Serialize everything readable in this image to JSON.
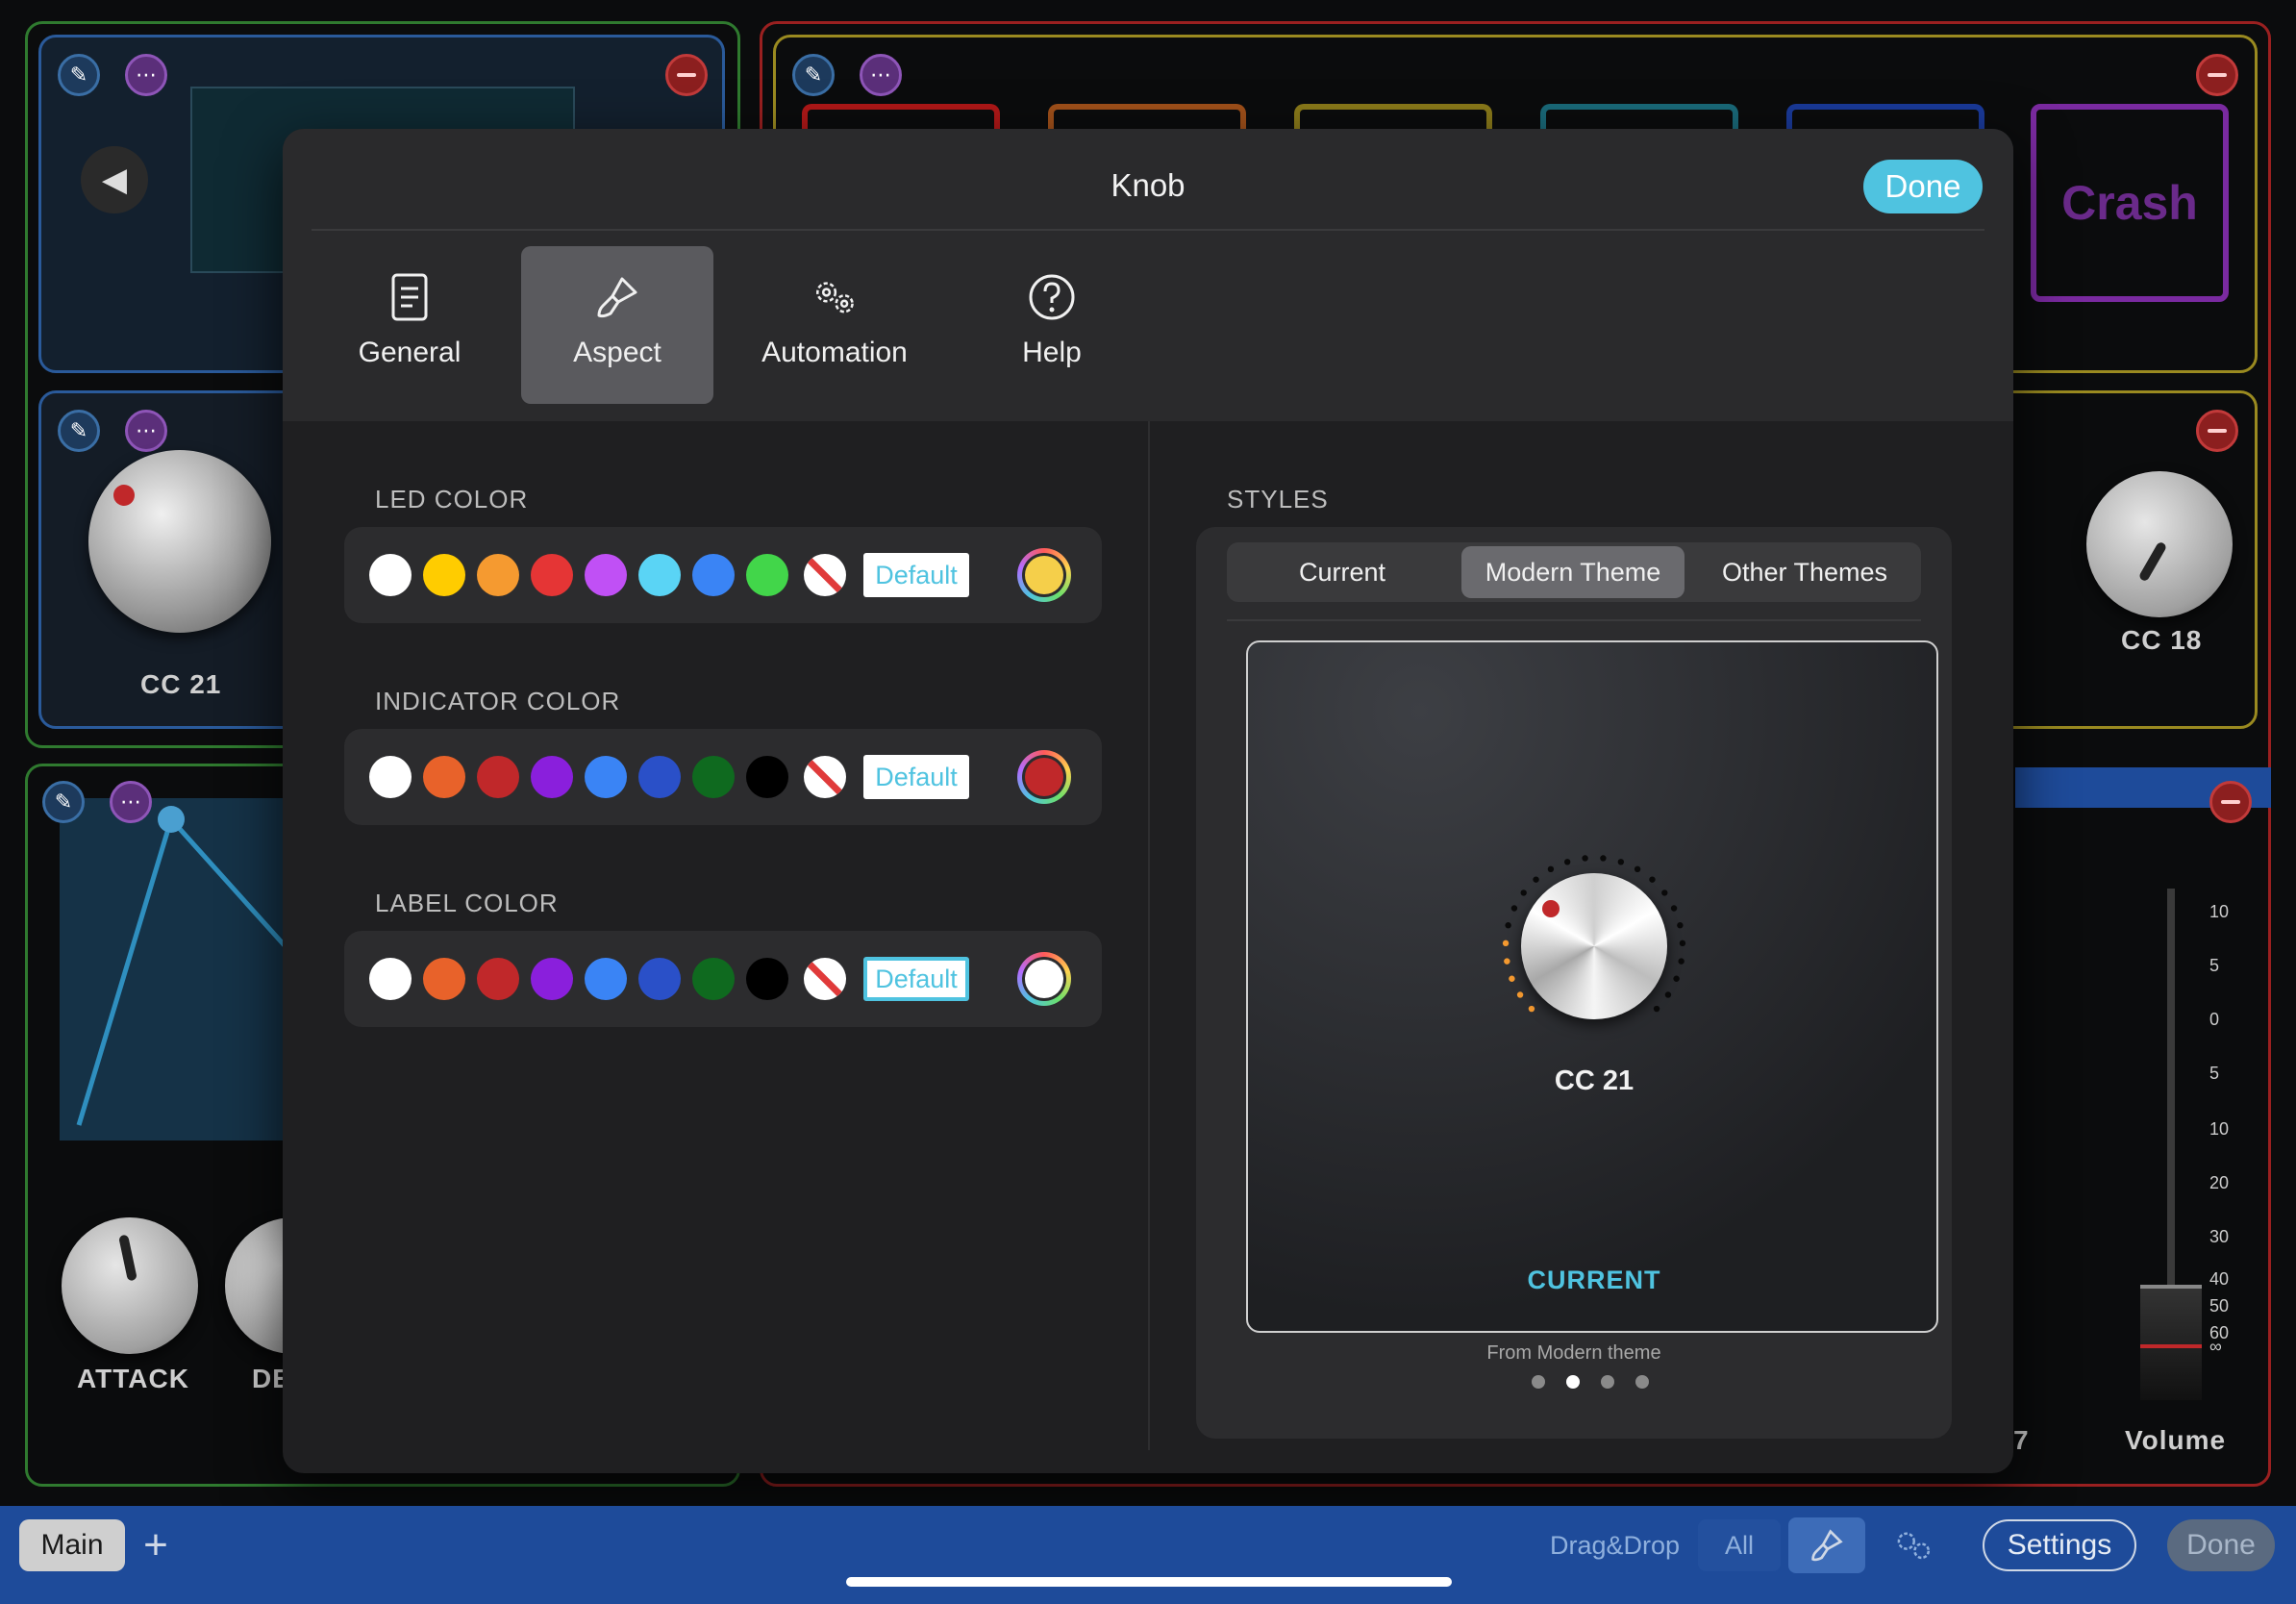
{
  "modal": {
    "title": "Knob",
    "done_label": "Done",
    "tabs": [
      {
        "label": "General",
        "icon": "document-icon"
      },
      {
        "label": "Aspect",
        "icon": "paintbrush-icon"
      },
      {
        "label": "Automation",
        "icon": "gears-icon"
      },
      {
        "label": "Help",
        "icon": "question-icon"
      }
    ],
    "active_tab": "Aspect"
  },
  "colors": {
    "led": {
      "title": "LED COLOR",
      "swatches": [
        "#ffffff",
        "#ffcc00",
        "#f59a30",
        "#e53535",
        "#c050f5",
        "#5ad4f5",
        "#3a84f5",
        "#42d64a"
      ],
      "default_label": "Default",
      "current": "#f5cf4a"
    },
    "indicator": {
      "title": "INDICATOR COLOR",
      "swatches": [
        "#ffffff",
        "#e8622a",
        "#c0282a",
        "#8a1fdc",
        "#3a84f5",
        "#2a50c8",
        "#0f6a1f",
        "#000000"
      ],
      "default_label": "Default",
      "current": "#c0282a"
    },
    "label": {
      "title": "LABEL COLOR",
      "swatches": [
        "#ffffff",
        "#e8622a",
        "#c0282a",
        "#8a1fdc",
        "#3a84f5",
        "#2a50c8",
        "#0f6a1f",
        "#000000"
      ],
      "default_label": "Default",
      "current": "#ffffff"
    }
  },
  "styles": {
    "title": "STYLES",
    "segments": [
      "Current",
      "Modern Theme",
      "Other Themes"
    ],
    "active_segment": "Modern Theme",
    "preview_label": "CC 21",
    "preview_status": "CURRENT",
    "caption": "From Modern theme",
    "page_count": 4,
    "page_active": 2
  },
  "background": {
    "crash_label": "Crash",
    "knob_labels": [
      "CC 21",
      "CC 18",
      "ATTACK",
      "DE"
    ],
    "volume_label": "Volume",
    "scale": [
      "10",
      "5",
      "0",
      "5",
      "10",
      "20",
      "30",
      "40",
      "50",
      "60",
      "∞"
    ],
    "partial_digit": "7"
  },
  "bottom_bar": {
    "main_tab": "Main",
    "add_icon": "plus-icon",
    "dragdrop": "Drag&Drop",
    "all": "All",
    "settings": "Settings",
    "done": "Done"
  }
}
